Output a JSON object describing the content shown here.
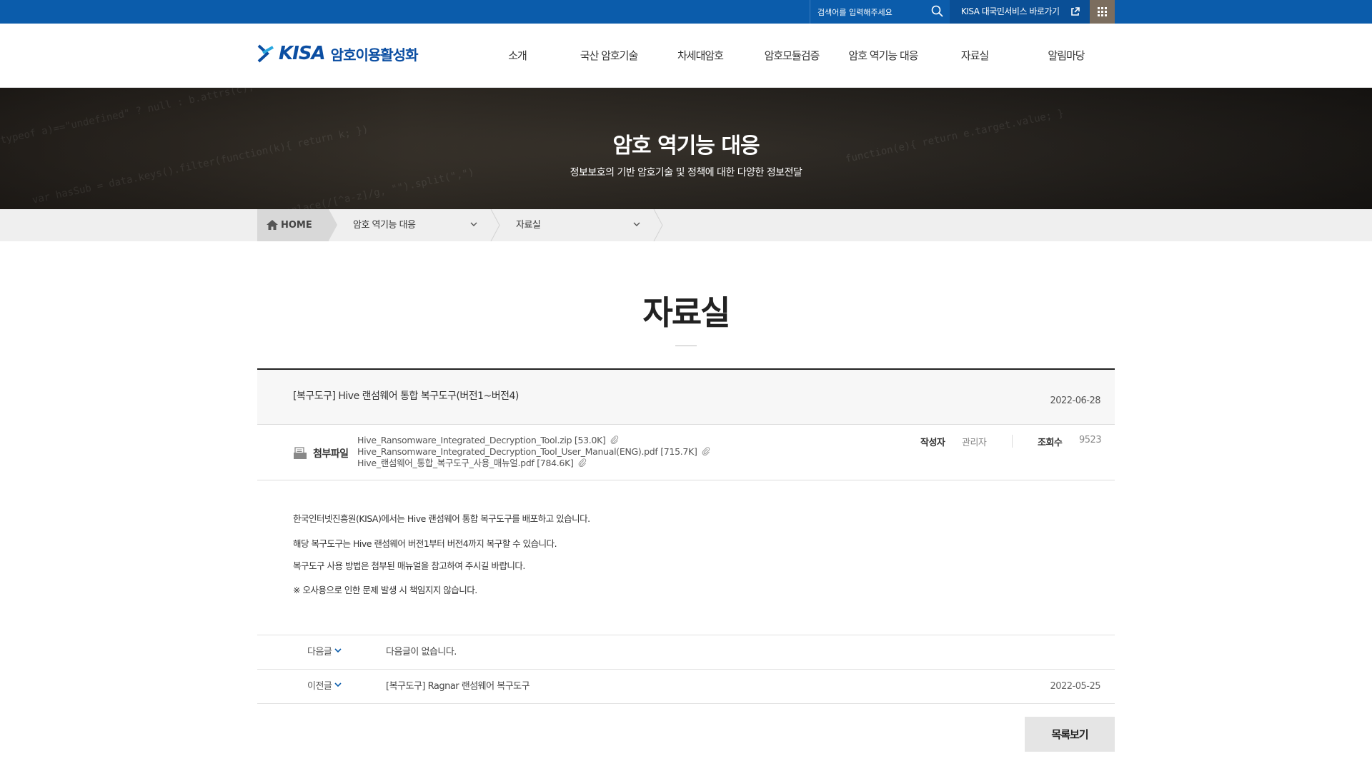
{
  "topbar": {
    "search_placeholder": "검색어를 입력해주세요",
    "kisa_link": "KISA 대국민서비스 바로가기"
  },
  "header": {
    "logo_brand": "KISA",
    "logo_site": "암호이용활성화",
    "nav": [
      "소개",
      "국산 암호기술",
      "차세대암호",
      "암호모듈검증",
      "암호 역기능 대응",
      "자료실",
      "알림마당"
    ]
  },
  "banner": {
    "title": "암호 역기능 대응",
    "subtitle": "정보보호의 기반 암호기술 및 정책에 대한 다양한 정보전달"
  },
  "breadcrumb": {
    "home": "HOME",
    "level1": "암호 역기능 대응",
    "level2": "자료실"
  },
  "page": {
    "title": "자료실"
  },
  "post": {
    "subject": "[복구도구] Hive 랜섬웨어 통합 복구도구(버전1~버전4)",
    "date": "2022-06-28",
    "attach_label": "첨부파일",
    "files": [
      "Hive_Ransomware_Integrated_Decryption_Tool.zip [53.0K]",
      "Hive_Ransomware_Integrated_Decryption_Tool_User_Manual(ENG).pdf [715.7K]",
      "Hive_랜섬웨어_통합_복구도구_사용_매뉴얼.pdf [784.6K]"
    ],
    "author_label": "작성자",
    "author": "관리자",
    "views_label": "조회수",
    "views": "9523",
    "body": [
      "한국인터넷진흥원(KISA)에서는 Hive 랜섬웨어 통합 복구도구를 배포하고 있습니다.",
      "해당 복구도구는 Hive 랜섬웨어 버전1부터 버전4까지 복구할 수 있습니다.",
      "복구도구 사용 방법은 첨부된 매뉴얼을 참고하여 주시길 바랍니다.",
      "※ 오사용으로 인한 문제 발생 시 책임지지 않습니다."
    ]
  },
  "post_nav": {
    "next_label": "다음글",
    "next_title": "다음글이 없습니다.",
    "prev_label": "이전글",
    "prev_title": "[복구도구] Ragnar 랜섬웨어 복구도구",
    "prev_date": "2022-05-25"
  },
  "list_button": "목록보기",
  "colors": {
    "topbar": "#0b5cab",
    "kisa_link_bg": "#0a4f96",
    "grid_btn_bg": "#7b6d5e",
    "brand": "#0b4ea2"
  },
  "icons": [
    "search-icon",
    "external-link-icon",
    "grid-menu-icon",
    "home-icon",
    "chevron-down-icon",
    "attachment-icon",
    "paperclip-icon"
  ]
}
